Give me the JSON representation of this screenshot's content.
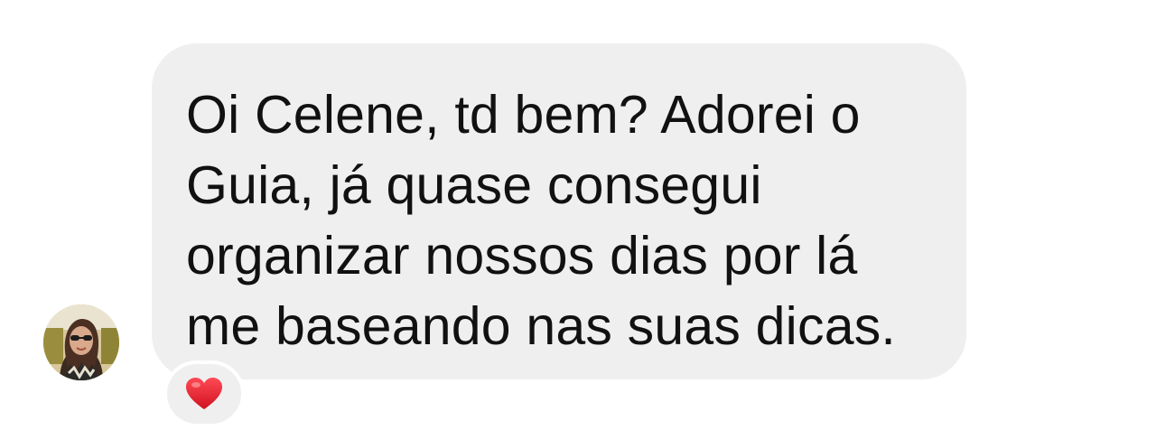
{
  "message": {
    "text": "Oi Celene, td bem? Adorei o\nGuia, já quase consegui\norganizar nossos dias por lá\nme baseando nas suas dicas."
  },
  "reaction": {
    "emoji": "❤️",
    "icon": "red-heart-icon",
    "color": "#e8222f"
  },
  "avatar": {
    "icon": "user-avatar"
  },
  "colors": {
    "bubble": "#efefef",
    "background": "#ffffff",
    "text": "#111111"
  }
}
